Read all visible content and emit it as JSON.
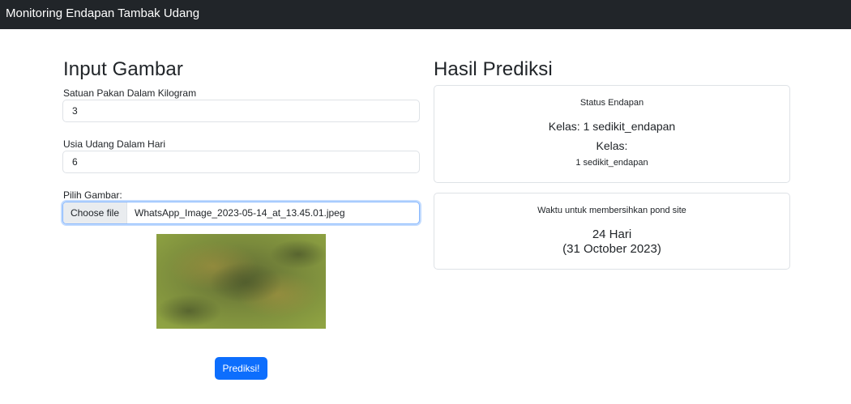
{
  "navbar": {
    "brand": "Monitoring Endapan Tambak Udang"
  },
  "input_section": {
    "title": "Input Gambar",
    "feed_label": "Satuan Pakan Dalam Kilogram",
    "feed_value": "3",
    "age_label": "Usia Udang Dalam Hari",
    "age_value": "6",
    "image_label": "Pilih Gambar:",
    "file_button": "Choose file",
    "file_name": "WhatsApp_Image_2023-05-14_at_13.45.01.jpeg",
    "submit_label": "Prediksi!"
  },
  "result_section": {
    "title": "Hasil Prediksi",
    "status_card": {
      "heading": "Status Endapan",
      "class_line": "Kelas: 1 sedikit_endapan",
      "class_label": "Kelas:",
      "class_value": "1 sedikit_endapan"
    },
    "time_card": {
      "heading": "Waktu untuk membersihkan pond site",
      "days": "24 Hari",
      "date": "(31 October 2023)"
    }
  },
  "colors": {
    "navbar": "#212529",
    "primary": "#0d6efd",
    "border": "#dee2e6",
    "focus_border": "#86b7fe"
  }
}
